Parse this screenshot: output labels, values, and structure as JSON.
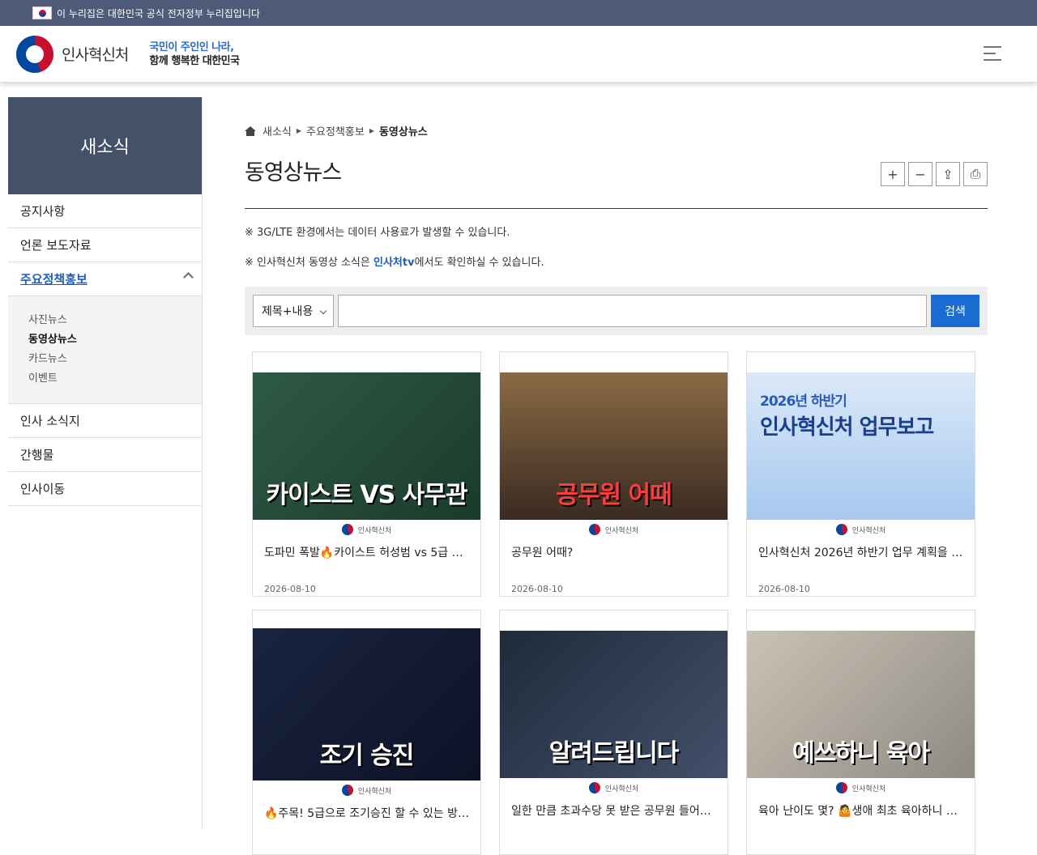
{
  "gov_banner": {
    "text": "이 누리집은 대한민국 공식 전자정부 누리집입니다"
  },
  "header": {
    "logo_text": "인사혁신처",
    "slogan_line1": "국민이 주인인 나라,",
    "slogan_line2": "함께 행복한 대한민국"
  },
  "sidebar": {
    "title": "새소식",
    "items": [
      {
        "label": "공지사항"
      },
      {
        "label": "언론 보도자료"
      },
      {
        "label": "주요정책홍보"
      },
      {
        "label": "인사 소식지"
      },
      {
        "label": "간행물"
      },
      {
        "label": "인사이동"
      }
    ],
    "sub_items": [
      {
        "label": "사진뉴스"
      },
      {
        "label": "동영상뉴스"
      },
      {
        "label": "카드뉴스"
      },
      {
        "label": "이벤트"
      }
    ]
  },
  "breadcrumb": {
    "level1": "새소식",
    "level2": "주요정책홍보",
    "level3": "동영상뉴스"
  },
  "page": {
    "title": "동영상뉴스"
  },
  "tools": {
    "zoom_in": "+",
    "zoom_out": "−",
    "share": "⇪",
    "print": "⎙"
  },
  "notices": {
    "line1": "※ 3G/LTE 환경에서는 데이터 사용료가 발생할 수 있습니다.",
    "line2_pre": "※ 인사혁신처 동영상 소식은 ",
    "line2_link": "인사처tv",
    "line2_post": "에서도 확인하실 수 있습니다."
  },
  "search": {
    "select_value": "제목+내용",
    "input_value": "",
    "button_label": "검색"
  },
  "channel_name": "인사혁신처",
  "videos": [
    {
      "thumb_caption": "카이스트 VS 사무관",
      "title": "도파민 폭발🔥카이스트 허성범 vs 5급 사…",
      "date": "2026-08-10"
    },
    {
      "thumb_caption": "공무원 어때",
      "title": "공무원 어때?",
      "date": "2026-08-10"
    },
    {
      "thumb_caption_small": "2026년 하반기",
      "thumb_caption": "인사혁신처 업무보고",
      "title": "인사혁신처 2026년 하반기 업무 계획을 …",
      "date": "2026-08-10"
    },
    {
      "thumb_caption": "조기 승진",
      "title": "🔥주목! 5급으로 조기승진 할 수 있는 방…",
      "date": ""
    },
    {
      "thumb_caption": "알려드립니다",
      "title": "일한 만큼 초과수당 못 받은 공무원 들어오…",
      "date": ""
    },
    {
      "thumb_caption": "예쓰하니 육아",
      "title": "육아 난이도 몇? 🤷생애 최초 육아하니 예…",
      "date": ""
    }
  ]
}
